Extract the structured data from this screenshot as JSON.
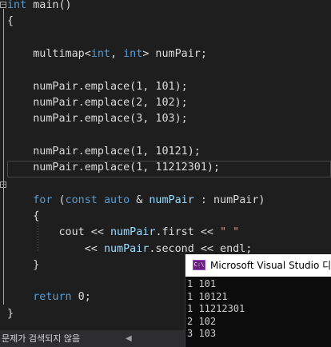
{
  "editor": {
    "lines": [
      [
        {
          "t": "int",
          "c": "kw"
        },
        {
          "t": " main()",
          "c": "id"
        }
      ],
      [
        {
          "t": "{",
          "c": "id"
        }
      ],
      [],
      [
        {
          "t": "    multimap<",
          "c": "id"
        },
        {
          "t": "int",
          "c": "kw"
        },
        {
          "t": ", ",
          "c": "id"
        },
        {
          "t": "int",
          "c": "kw"
        },
        {
          "t": "> numPair;",
          "c": "id"
        }
      ],
      [],
      [
        {
          "t": "    numPair.emplace(1, 101);",
          "c": "id"
        }
      ],
      [
        {
          "t": "    numPair.emplace(2, 102);",
          "c": "id"
        }
      ],
      [
        {
          "t": "    numPair.emplace(3, 103);",
          "c": "id"
        }
      ],
      [],
      [
        {
          "t": "    numPair.emplace(1, 10121);",
          "c": "id"
        }
      ],
      [
        {
          "t": "    numPair.emplace(1, 11212301);",
          "c": "id"
        }
      ],
      [],
      [
        {
          "t": "    ",
          "c": "id"
        },
        {
          "t": "for",
          "c": "kw"
        },
        {
          "t": " (",
          "c": "id"
        },
        {
          "t": "const",
          "c": "kw"
        },
        {
          "t": " ",
          "c": "id"
        },
        {
          "t": "auto",
          "c": "kw"
        },
        {
          "t": " & ",
          "c": "id"
        },
        {
          "t": "numPair",
          "c": "vr"
        },
        {
          "t": " : numPair)",
          "c": "id"
        }
      ],
      [
        {
          "t": "    {",
          "c": "id"
        }
      ],
      [
        {
          "t": "        cout << ",
          "c": "id"
        },
        {
          "t": "numPair",
          "c": "vr"
        },
        {
          "t": ".first << ",
          "c": "id"
        },
        {
          "t": "\" \"",
          "c": "st"
        }
      ],
      [
        {
          "t": "            << ",
          "c": "id"
        },
        {
          "t": "numPair",
          "c": "vr"
        },
        {
          "t": ".second << endl;",
          "c": "id"
        }
      ],
      [
        {
          "t": "    }",
          "c": "id"
        }
      ],
      [],
      [
        {
          "t": "    ",
          "c": "id"
        },
        {
          "t": "return",
          "c": "kw"
        },
        {
          "t": " 0;",
          "c": "id"
        }
      ],
      [
        {
          "t": "}",
          "c": "id"
        }
      ]
    ]
  },
  "status": {
    "text": "문제가 검색되지 않음",
    "arrow": "◀"
  },
  "console": {
    "icon": "C:\\",
    "title": "Microsoft Visual Studio 디버그 콘솔",
    "output": [
      "1 101",
      "1 10121",
      "1 11212301",
      "2 102",
      "3 103"
    ]
  },
  "colors": {
    "background": "#1e1e1e",
    "keyword": "#569cd6",
    "text": "#dcdcdc",
    "variable": "#9cdcfe",
    "string": "#d69d85",
    "console_bg": "#0c0c0c",
    "console_icon": "#68217a"
  }
}
